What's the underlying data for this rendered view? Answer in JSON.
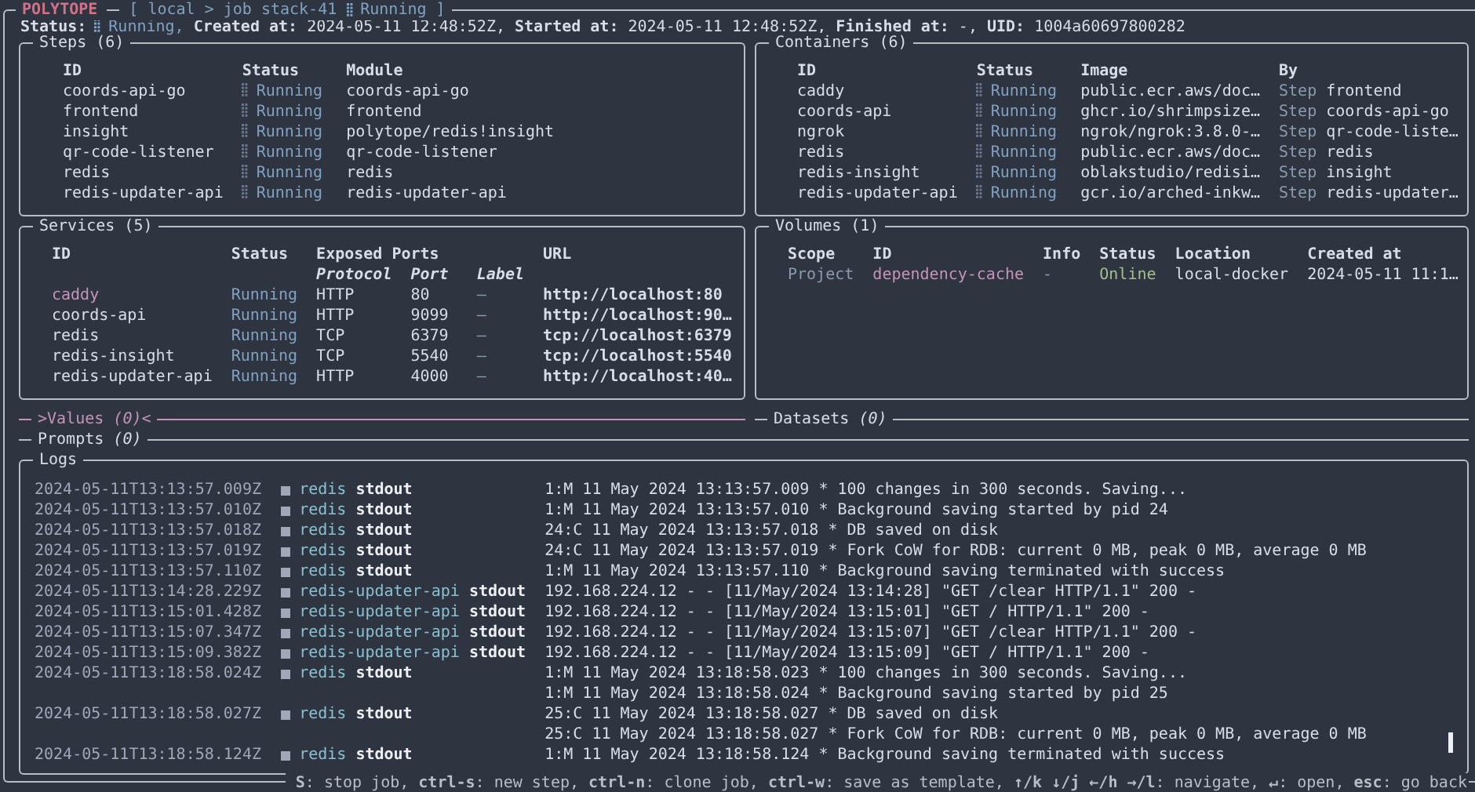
{
  "title_bar": {
    "app": "POLYTOPE",
    "breadcrumb": "[ local > job stack-41",
    "job_status": "Running ]"
  },
  "status_line": {
    "status_label": "Status:",
    "status_value": "Running,",
    "fields": [
      {
        "label": "Created at:",
        "value": "2024-05-11 12:48:52Z,"
      },
      {
        "label": "Started at:",
        "value": "2024-05-11 12:48:52Z,"
      },
      {
        "label": "Finished at:",
        "value": "-,"
      },
      {
        "label": "UID:",
        "value": "1004a60697800282"
      }
    ]
  },
  "steps": {
    "title": "Steps (6)",
    "columns": [
      "ID",
      "Status",
      "Module"
    ],
    "rows": [
      [
        "coords-api-go",
        "Running",
        "coords-api-go"
      ],
      [
        "frontend",
        "Running",
        "frontend"
      ],
      [
        "insight",
        "Running",
        "polytope/redis!insight"
      ],
      [
        "qr-code-listener",
        "Running",
        "qr-code-listener"
      ],
      [
        "redis",
        "Running",
        "redis"
      ],
      [
        "redis-updater-api",
        "Running",
        "redis-updater-api"
      ]
    ]
  },
  "containers": {
    "title": "Containers (6)",
    "columns": [
      "ID",
      "Status",
      "Image",
      "By"
    ],
    "rows": [
      [
        "caddy",
        "Running",
        "public.ecr.aws/doc…",
        "Step",
        "frontend"
      ],
      [
        "coords-api",
        "Running",
        "ghcr.io/shrimpsize…",
        "Step",
        "coords-api-go"
      ],
      [
        "ngrok",
        "Running",
        "ngrok/ngrok:3.8.0-…",
        "Step",
        "qr-code-liste…"
      ],
      [
        "redis",
        "Running",
        "public.ecr.aws/doc…",
        "Step",
        "redis"
      ],
      [
        "redis-insight",
        "Running",
        "oblakstudio/redisi…",
        "Step",
        "insight"
      ],
      [
        "redis-updater-api",
        "Running",
        "gcr.io/arched-inkw…",
        "Step",
        "redis-updater…"
      ]
    ]
  },
  "services": {
    "title": "Services (5)",
    "columns": [
      "ID",
      "Status",
      "Exposed Ports",
      "",
      "",
      "URL"
    ],
    "port_columns": [
      "",
      "",
      "Protocol",
      "Port",
      "Label",
      ""
    ],
    "rows": [
      {
        "cells": [
          "caddy",
          "Running",
          "HTTP",
          "80",
          "—",
          "http://localhost:80"
        ],
        "selected": true
      },
      {
        "cells": [
          "coords-api",
          "Running",
          "HTTP",
          "9099",
          "—",
          "http://localhost:90…"
        ],
        "selected": false
      },
      {
        "cells": [
          "redis",
          "Running",
          "TCP",
          "6379",
          "—",
          "tcp://localhost:6379"
        ],
        "selected": false
      },
      {
        "cells": [
          "redis-insight",
          "Running",
          "TCP",
          "5540",
          "—",
          "tcp://localhost:5540"
        ],
        "selected": false
      },
      {
        "cells": [
          "redis-updater-api",
          "Running",
          "HTTP",
          "4000",
          "—",
          "http://localhost:40…"
        ],
        "selected": false
      }
    ]
  },
  "volumes": {
    "title": "Volumes (1)",
    "columns": [
      "Scope",
      "ID",
      "Info",
      "Status",
      "Location",
      "Created at"
    ],
    "rows": [
      {
        "cells": [
          "Project",
          "dependency-cache",
          "-",
          "Online",
          "local-docker",
          "2024-05-11 11:1…"
        ],
        "selected": true
      }
    ]
  },
  "collapsed_panels": [
    {
      "title": ">Values *(0)*<",
      "selected": true
    },
    {
      "title": "Datasets *(0)*",
      "selected": false
    }
  ],
  "prompts": {
    "title": "Prompts *(0)*",
    "selected": false
  },
  "logs": {
    "title": "Logs",
    "entries": [
      {
        "time": "2024-05-11T13:13:57.009Z",
        "service": "redis",
        "stream": "stdout",
        "lines": [
          "1:M 11 May 2024 13:13:57.009 * 100 changes in 300 seconds. Saving..."
        ]
      },
      {
        "time": "2024-05-11T13:13:57.010Z",
        "service": "redis",
        "stream": "stdout",
        "lines": [
          "1:M 11 May 2024 13:13:57.010 * Background saving started by pid 24"
        ]
      },
      {
        "time": "2024-05-11T13:13:57.018Z",
        "service": "redis",
        "stream": "stdout",
        "lines": [
          "24:C 11 May 2024 13:13:57.018 * DB saved on disk"
        ]
      },
      {
        "time": "2024-05-11T13:13:57.019Z",
        "service": "redis",
        "stream": "stdout",
        "lines": [
          "24:C 11 May 2024 13:13:57.019 * Fork CoW for RDB: current 0 MB, peak 0 MB, average 0 MB"
        ]
      },
      {
        "time": "2024-05-11T13:13:57.110Z",
        "service": "redis",
        "stream": "stdout",
        "lines": [
          "1:M 11 May 2024 13:13:57.110 * Background saving terminated with success"
        ]
      },
      {
        "time": "2024-05-11T13:14:28.229Z",
        "service": "redis-updater-api",
        "stream": "stdout",
        "lines": [
          "192.168.224.12 - - [11/May/2024 13:14:28] \"GET /clear HTTP/1.1\" 200 -"
        ]
      },
      {
        "time": "2024-05-11T13:15:01.428Z",
        "service": "redis-updater-api",
        "stream": "stdout",
        "lines": [
          "192.168.224.12 - - [11/May/2024 13:15:01] \"GET / HTTP/1.1\" 200 -"
        ]
      },
      {
        "time": "2024-05-11T13:15:07.347Z",
        "service": "redis-updater-api",
        "stream": "stdout",
        "lines": [
          "192.168.224.12 - - [11/May/2024 13:15:07] \"GET /clear HTTP/1.1\" 200 -"
        ]
      },
      {
        "time": "2024-05-11T13:15:09.382Z",
        "service": "redis-updater-api",
        "stream": "stdout",
        "lines": [
          "192.168.224.12 - - [11/May/2024 13:15:09] \"GET / HTTP/1.1\" 200 -"
        ]
      },
      {
        "time": "2024-05-11T13:18:58.024Z",
        "service": "redis",
        "stream": "stdout",
        "lines": [
          "1:M 11 May 2024 13:18:58.023 * 100 changes in 300 seconds. Saving...",
          "1:M 11 May 2024 13:18:58.024 * Background saving started by pid 25"
        ]
      },
      {
        "time": "2024-05-11T13:18:58.027Z",
        "service": "redis",
        "stream": "stdout",
        "lines": [
          "25:C 11 May 2024 13:18:58.027 * DB saved on disk",
          "25:C 11 May 2024 13:18:58.027 * Fork CoW for RDB: current 0 MB, peak 0 MB, average 0 MB"
        ]
      },
      {
        "time": "2024-05-11T13:18:58.124Z",
        "service": "redis",
        "stream": "stdout",
        "lines": [
          "1:M 11 May 2024 13:18:58.124 * Background saving terminated with success"
        ]
      }
    ]
  },
  "key_hints": "**S**: stop job, **ctrl-s**: new step, **ctrl-n**: clone job, **ctrl-w**: save as template, **↑/k ↓/j ←/h →/l**: navigate, **↵**: open, **esc**: go back"
}
